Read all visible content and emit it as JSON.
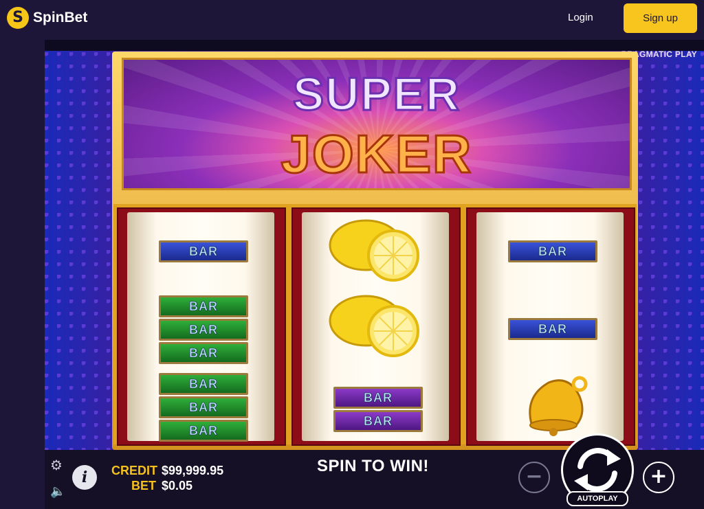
{
  "header": {
    "brand": "SpinBet",
    "login_label": "Login",
    "signup_label": "Sign up"
  },
  "game": {
    "provider": "PRAGMATIC PLAY",
    "title_line1": "SUPER",
    "title_line2": "JOKER",
    "reels": [
      {
        "symbols": [
          "BAR (blue)",
          "3 BAR (green)",
          "3 BAR (green)"
        ]
      },
      {
        "symbols": [
          "Lemon",
          "Lemon",
          "2 BAR (purple)"
        ]
      },
      {
        "symbols": [
          "BAR (blue)",
          "BAR (blue)",
          "Bell"
        ]
      }
    ],
    "bar_label": "BAR",
    "message": "SPIN TO WIN!"
  },
  "controls": {
    "credit_label": "CREDIT",
    "credit_value": "$99,999.95",
    "bet_label": "BET",
    "bet_value": "$0.05",
    "autoplay_label": "AUTOPLAY",
    "minus_symbol": "−",
    "plus_symbol": "+",
    "info_symbol": "i",
    "gear_symbol": "⚙",
    "speaker_symbol": "🔈"
  },
  "colors": {
    "accent": "#f7c51e",
    "background": "#1e1638",
    "reel_frame": "#8c0d17"
  }
}
